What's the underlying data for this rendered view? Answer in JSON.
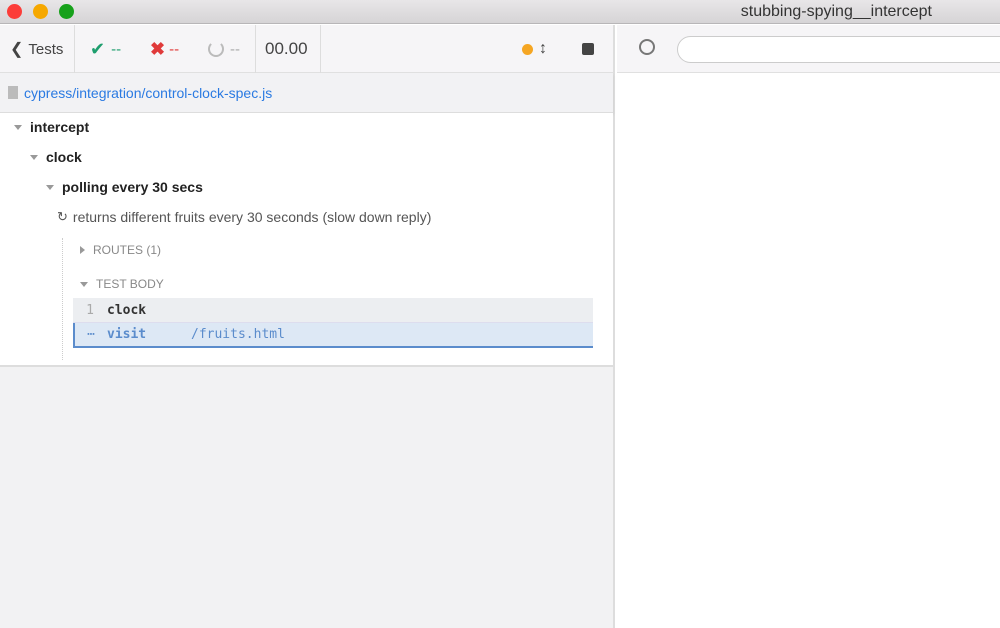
{
  "window": {
    "title": "stubbing-spying__intercept"
  },
  "toolbar": {
    "back_label": "Tests",
    "passed": "--",
    "failed": "--",
    "pending": "--",
    "duration": "00.00"
  },
  "spec": {
    "path": "cypress/integration/control-clock-spec.js"
  },
  "tree": {
    "suite1": "intercept",
    "suite2": "clock",
    "suite3": "polling every 30 secs",
    "test": "returns different fruits every 30 seconds (slow down reply)",
    "routes": "ROUTES (1)",
    "test_body": "TEST BODY",
    "commands": [
      {
        "num": "1",
        "name": "clock",
        "message": ""
      },
      {
        "num": "",
        "name": "visit",
        "message": "/fruits.html"
      }
    ]
  },
  "url": {
    "value": ""
  }
}
